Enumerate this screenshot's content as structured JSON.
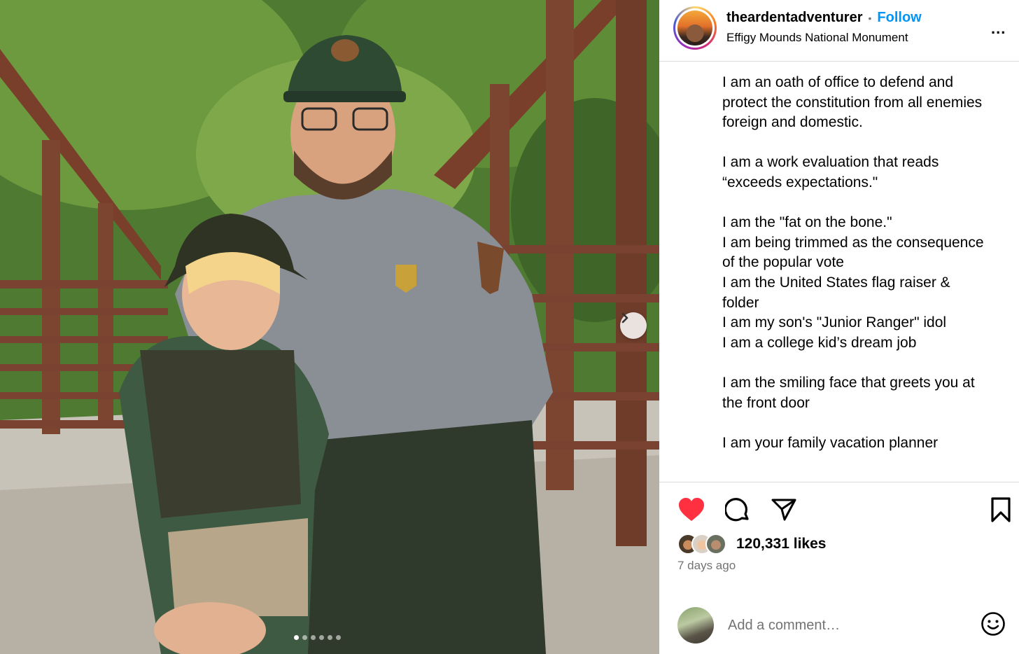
{
  "post": {
    "username": "theardentadventurer",
    "separator": "•",
    "follow_label": "Follow",
    "location": "Effigy Mounds National Monument",
    "more_label": "..."
  },
  "media": {
    "carousel_dots": 6,
    "active_dot": 0,
    "next_icon": "chevron-right-icon"
  },
  "caption": {
    "paragraphs": [
      [
        "I am an oath of office to defend and",
        "protect the constitution from all enemies",
        "foreign and domestic."
      ],
      [
        "I am a work evaluation that reads",
        "“exceeds expectations.\""
      ],
      [
        "I am the \"fat on the bone.\"",
        "I am being trimmed as the consequence",
        "of the popular vote",
        "I am the United States flag raiser &",
        "folder",
        "I am my son's \"Junior Ranger\" idol",
        "I am a college kid’s dream job"
      ],
      [
        "I am the smiling face that greets you at",
        "the front door"
      ],
      [
        "I am your family vacation planner"
      ]
    ]
  },
  "actions": {
    "like_icon": "heart-filled-icon",
    "comment_icon": "comment-icon",
    "share_icon": "send-icon",
    "save_icon": "bookmark-icon",
    "like_color": "#ff3040"
  },
  "stats": {
    "likes": "120,331 likes",
    "time": "7 days ago"
  },
  "comment": {
    "placeholder": "Add a comment…",
    "emoji_icon": "smiley-icon"
  }
}
